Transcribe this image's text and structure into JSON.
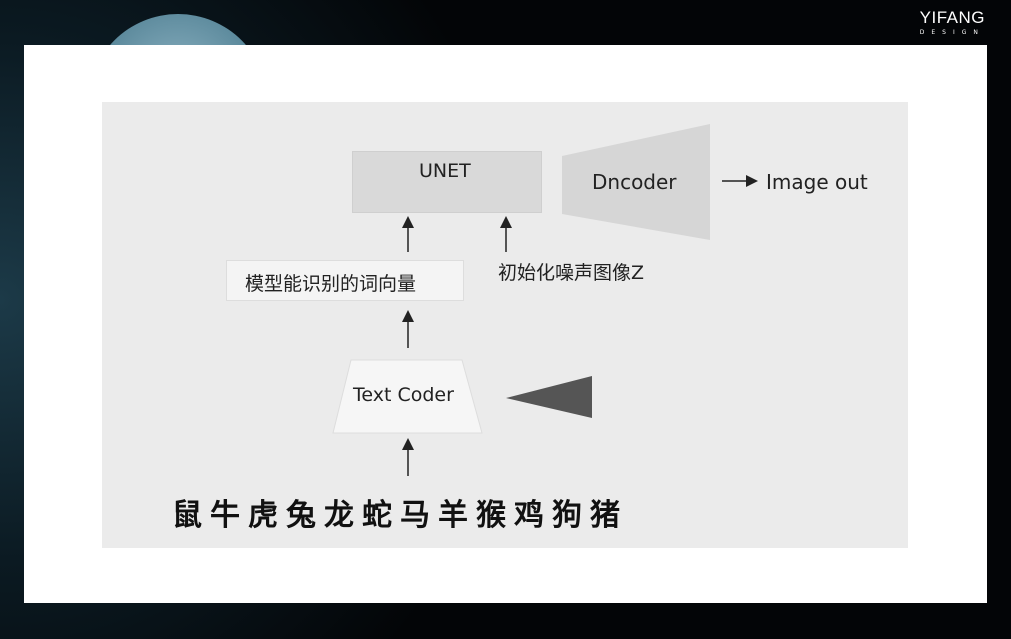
{
  "brand": {
    "name": "YIFANG",
    "tagline": "DESIGN"
  },
  "diagram": {
    "unet": "UNET",
    "decoder": "Dncoder",
    "output": "Image out",
    "noise": "初始化噪声图像Z",
    "word_vectors": "模型能识别的词向量",
    "text_coder": "Text Coder",
    "input_words": "鼠牛虎兔龙蛇马羊猴鸡狗猪"
  }
}
